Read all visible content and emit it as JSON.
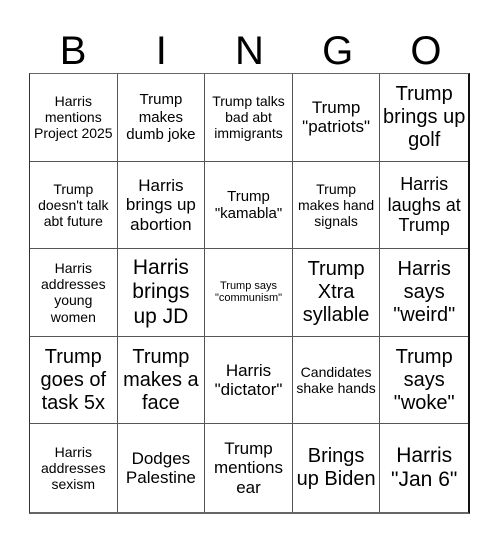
{
  "header": {
    "letters": [
      "B",
      "I",
      "N",
      "G",
      "O"
    ]
  },
  "cells": [
    [
      "Harris mentions Project 2025",
      "Trump makes dumb joke",
      "Trump talks bad abt immigrants",
      "Trump \"patriots\"",
      "Trump brings up golf"
    ],
    [
      "Trump doesn't talk abt future",
      "Harris brings up abortion",
      "Trump \"kamabla\"",
      "Trump makes hand signals",
      "Harris laughs at Trump"
    ],
    [
      "Harris addresses young women",
      "Harris brings up JD",
      "Trump says \"communism\"",
      "Trump Xtra syllable",
      "Harris says \"weird\""
    ],
    [
      "Trump goes of task 5x",
      "Trump makes a face",
      "Harris \"dictator\"",
      "Candidates shake hands",
      "Trump says \"woke\""
    ],
    [
      "Harris addresses sexism",
      "Dodges Palestine",
      "Trump mentions ear",
      "Brings up Biden",
      "Harris \"Jan 6\""
    ]
  ]
}
